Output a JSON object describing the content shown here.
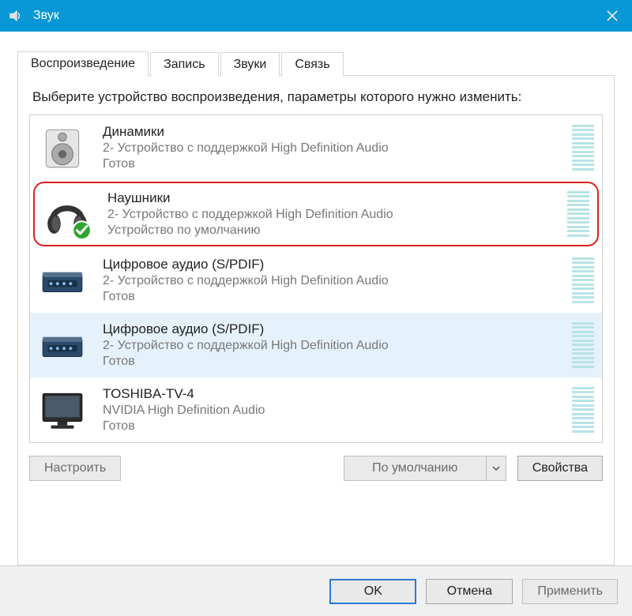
{
  "titlebar": {
    "title": "Звук"
  },
  "tabs": [
    {
      "label": "Воспроизведение",
      "active": true
    },
    {
      "label": "Запись"
    },
    {
      "label": "Звуки"
    },
    {
      "label": "Связь"
    }
  ],
  "instruction": "Выберите устройство воспроизведения, параметры которого нужно изменить:",
  "devices": [
    {
      "icon": "speaker",
      "title": "Динамики",
      "sub": "2- Устройство с поддержкой High Definition Audio",
      "status": "Готов",
      "selected": false,
      "highlight": false,
      "default_badge": false
    },
    {
      "icon": "headphones",
      "title": "Наушники",
      "sub": "2- Устройство с поддержкой High Definition Audio",
      "status": "Устройство по умолчанию",
      "selected": false,
      "highlight": true,
      "default_badge": true
    },
    {
      "icon": "spdif",
      "title": "Цифровое аудио (S/PDIF)",
      "sub": "2- Устройство с поддержкой High Definition Audio",
      "status": "Готов",
      "selected": false,
      "highlight": false,
      "default_badge": false
    },
    {
      "icon": "spdif",
      "title": "Цифровое аудио (S/PDIF)",
      "sub": "2- Устройство с поддержкой High Definition Audio",
      "status": "Готов",
      "selected": true,
      "highlight": false,
      "default_badge": false
    },
    {
      "icon": "tv",
      "title": "TOSHIBA-TV-4",
      "sub": "NVIDIA High Definition Audio",
      "status": "Готов",
      "selected": false,
      "highlight": false,
      "default_badge": false
    }
  ],
  "panel_buttons": {
    "configure": "Настроить",
    "set_default": "По умолчанию",
    "properties": "Свойства"
  },
  "footer": {
    "ok": "OK",
    "cancel": "Отмена",
    "apply": "Применить"
  }
}
